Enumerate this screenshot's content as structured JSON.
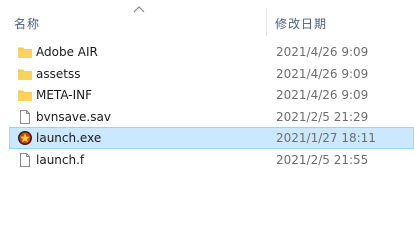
{
  "header": {
    "name_label": "名称",
    "date_label": "修改日期"
  },
  "files": [
    {
      "name": "Adobe AIR",
      "modified": "2021/4/26 9:09",
      "icon": "folder-icon"
    },
    {
      "name": "assetss",
      "modified": "2021/4/26 9:09",
      "icon": "folder-icon"
    },
    {
      "name": "META-INF",
      "modified": "2021/4/26 9:09",
      "icon": "folder-icon"
    },
    {
      "name": "bvnsave.sav",
      "modified": "2021/2/5 21:29",
      "icon": "file-icon"
    },
    {
      "name": "launch.exe",
      "modified": "2021/1/27 18:11",
      "icon": "app-icon",
      "selected": true
    },
    {
      "name": "launch.f",
      "modified": "2021/2/5 21:55",
      "icon": "file-icon"
    }
  ],
  "colors": {
    "selection_bg": "#cce8ff",
    "selection_border": "#99d1ff",
    "folder": "#f8c849",
    "header_text": "#4c607a",
    "date_text": "#6d6d6d"
  }
}
